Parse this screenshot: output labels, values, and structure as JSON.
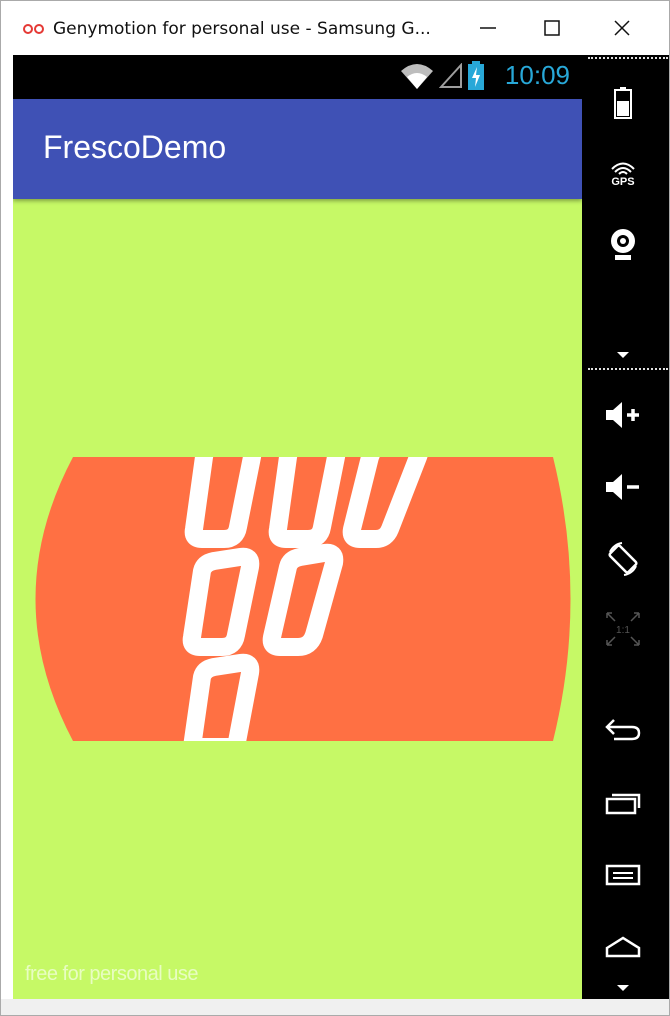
{
  "window": {
    "title": "Genymotion for personal use - Samsung G...",
    "minimize_label": "—",
    "maximize_label": "☐",
    "close_label": "✕"
  },
  "status_bar": {
    "time": "10:09",
    "icons": [
      "wifi-icon",
      "signal-icon",
      "battery-charging-icon"
    ],
    "time_color": "#28a8d8"
  },
  "app_bar": {
    "title": "FrescoDemo",
    "color": "#3f51b5"
  },
  "content": {
    "background_color": "#c6f966",
    "image": {
      "description_icon": "fresco-logo-image",
      "color": "#ff7043"
    }
  },
  "watermark": "free for personal use",
  "sidebar": {
    "gps_label": "GPS",
    "ratio_label": "1:1",
    "items": [
      "battery-icon",
      "gps-icon",
      "webcam-icon",
      "expand-arrow-icon",
      "volume-up-icon",
      "volume-down-icon",
      "rotate-icon",
      "pixel-perfect-icon",
      "back-icon",
      "recent-apps-icon",
      "menu-icon",
      "home-icon",
      "scroll-down-arrow-icon"
    ]
  }
}
